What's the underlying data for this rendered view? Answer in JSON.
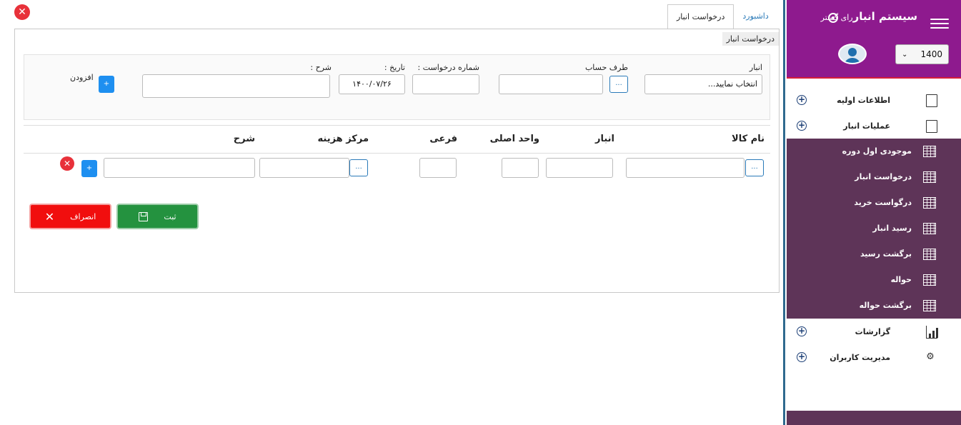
{
  "sidebar": {
    "title": "سیستم انبار",
    "title_suffix": "رای گستر",
    "year": "1400",
    "menu": [
      {
        "label": "اطلاعات اولیه",
        "icon": "documents-icon"
      },
      {
        "label": "عملیات انبار",
        "icon": "documents-icon"
      }
    ],
    "submenu": [
      {
        "label": "موجودی اول دوره"
      },
      {
        "label": "درخواست انبار"
      },
      {
        "label": "درگواست خرید"
      },
      {
        "label": "رسید انبار"
      },
      {
        "label": "برگشت رسید"
      },
      {
        "label": "حواله"
      },
      {
        "label": "برگشت حواله"
      }
    ],
    "menu_bottom": [
      {
        "label": "گزارشات",
        "icon": "bar-chart-icon"
      },
      {
        "label": "مدیریت کاربران",
        "icon": "users-icon"
      }
    ]
  },
  "tabs": [
    {
      "label": "داشبورد",
      "active": false
    },
    {
      "label": "درخواست انبار",
      "active": true
    }
  ],
  "panel": {
    "title": "درخواست انبار",
    "form": {
      "warehouse_label": "انبار",
      "warehouse_value": "انتخاب نمایید...",
      "account_label": "طرف حساب",
      "request_no_label": "شماره درخواست :",
      "date_label": "تاریخ :",
      "date_value": "۱۴۰۰/۰۷/۲۶",
      "description_label": "شرح :",
      "add_label": "افزودن",
      "plus": "+",
      "dots": "..."
    },
    "table": {
      "headers": [
        "نام کالا",
        "انبار",
        "واحد اصلی",
        "فرعی",
        "مرکز هزینه",
        "شرح"
      ]
    },
    "buttons": {
      "save": "ثبت",
      "cancel": "انصراف"
    }
  },
  "colors": {
    "sidebar_header": "#8e1a8e",
    "submenu_bg": "#5e3458",
    "save_green": "#24923f",
    "cancel_red": "#f10e0e",
    "primary_blue": "#1e8ff0"
  }
}
